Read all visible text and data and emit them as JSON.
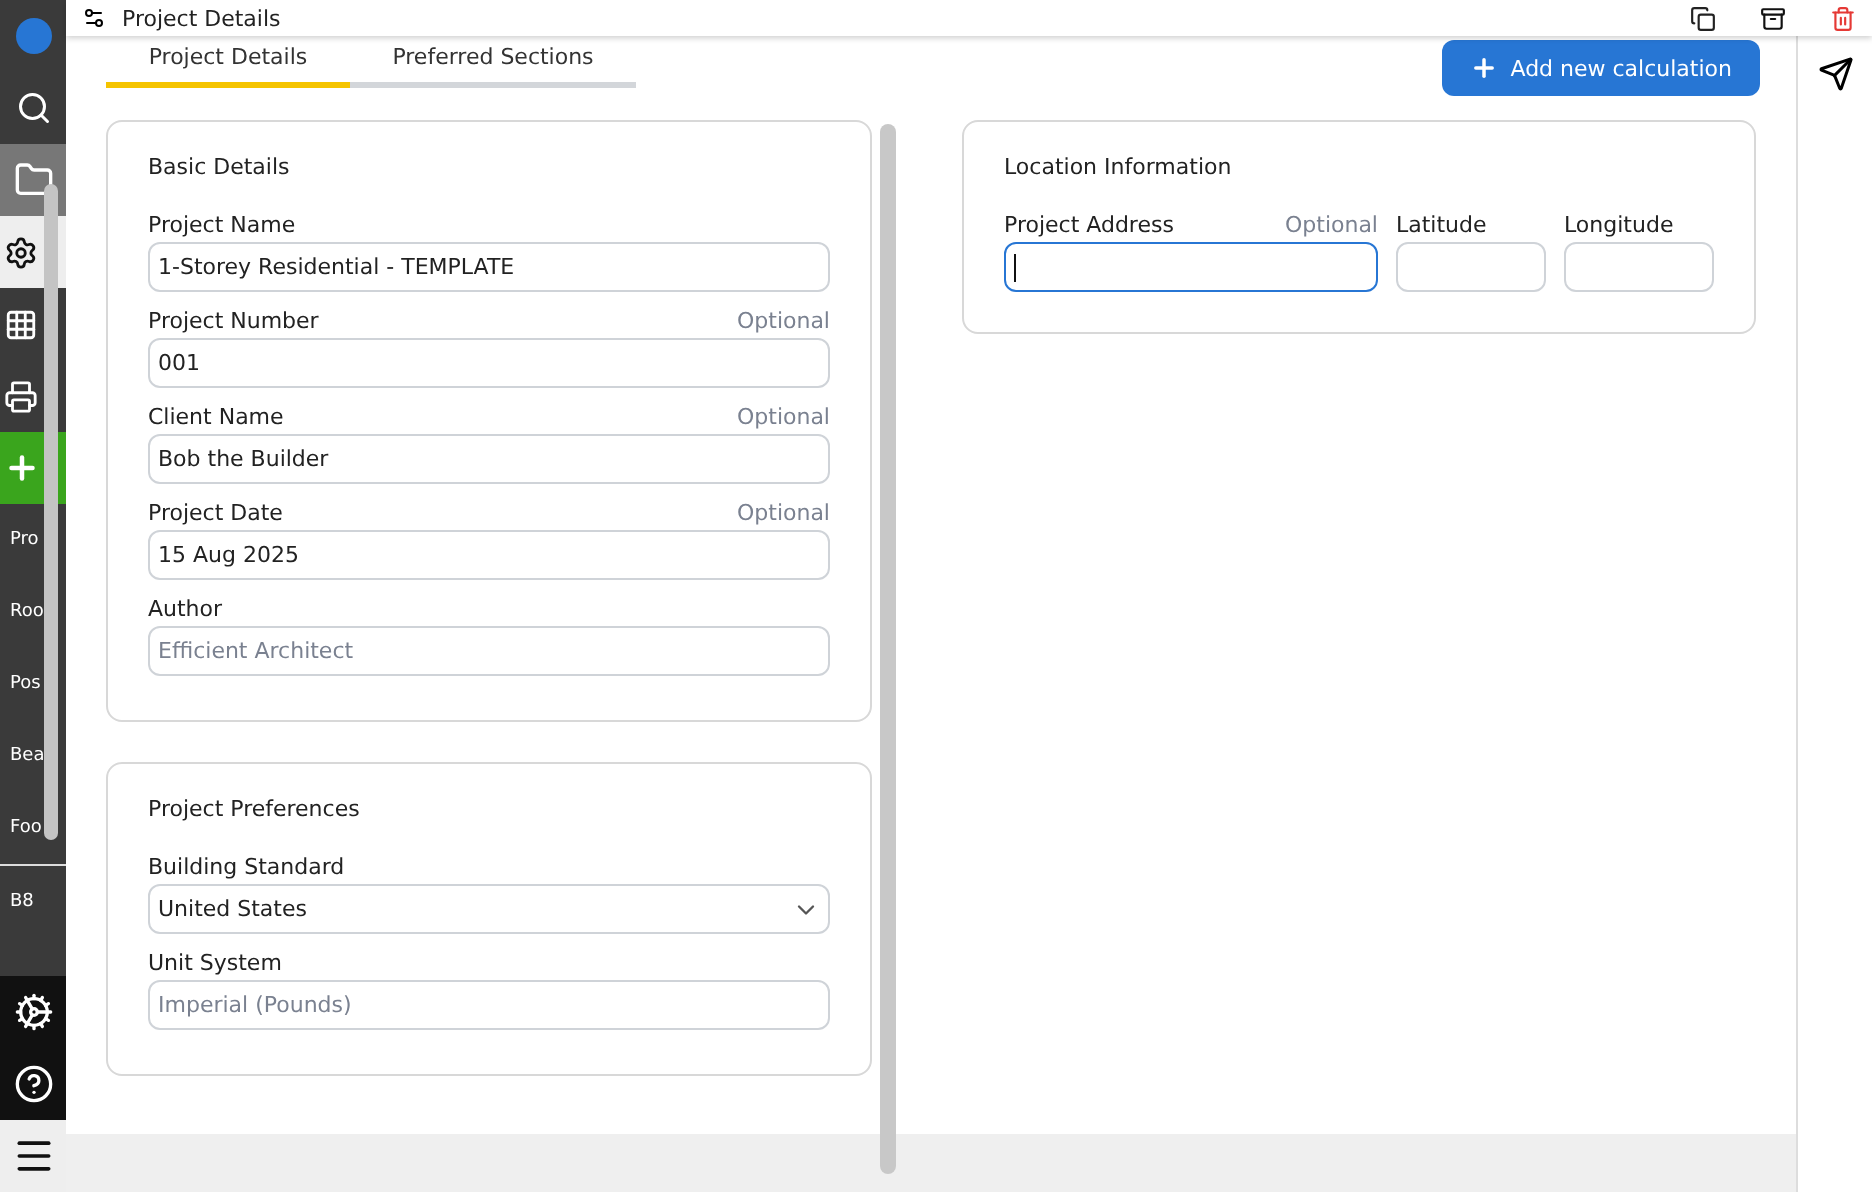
{
  "header": {
    "title": "Project Details"
  },
  "sidebar": {
    "items": [
      {
        "kind": "icon",
        "selected": false
      },
      {
        "kind": "icon",
        "selected": false
      },
      {
        "kind": "icon",
        "selected": false
      },
      {
        "kind": "icon",
        "selected": true
      },
      {
        "kind": "icon",
        "selected": false
      },
      {
        "kind": "icon",
        "selected": false
      },
      {
        "kind": "icon",
        "selected": false
      },
      {
        "kind": "text",
        "label": "Pro"
      },
      {
        "kind": "text",
        "label": "Roo"
      },
      {
        "kind": "text",
        "label": "Pos"
      },
      {
        "kind": "text",
        "label": "Bea"
      },
      {
        "kind": "text",
        "label": "Foo"
      },
      {
        "kind": "text",
        "label": "B8"
      }
    ]
  },
  "tabs": [
    {
      "label": "Project Details",
      "selected": true
    },
    {
      "label": "Preferred Sections",
      "selected": false
    }
  ],
  "add_button": {
    "label": "Add new calculation"
  },
  "cards": [
    {
      "title": "Basic Details",
      "fields": [
        {
          "kind": "text",
          "label": "Project Name",
          "value": "1-Storey Residential - TEMPLATE"
        },
        {
          "kind": "text",
          "label": "Project Number",
          "optional_label": "Optional",
          "value": "001"
        },
        {
          "kind": "text",
          "label": "Client Name",
          "optional_label": "Optional",
          "value": "Bob the Builder"
        },
        {
          "kind": "text",
          "label": "Project Date",
          "optional_label": "Optional",
          "value": "15 Aug 2025"
        },
        {
          "kind": "text",
          "label": "Author",
          "placeholder": "Efficient Architect"
        }
      ]
    },
    {
      "title": "Project Preferences",
      "fields": [
        {
          "kind": "select",
          "label": "Building Standard",
          "value": "United States"
        },
        {
          "kind": "text",
          "label": "Unit System",
          "placeholder": "Imperial (Pounds)"
        }
      ]
    }
  ],
  "location": {
    "title": "Location Information",
    "fields": [
      {
        "label": "Project Address",
        "optional_label": "Optional",
        "focused": true
      },
      {
        "label": "Latitude",
        "focused": false
      },
      {
        "label": "Longitude",
        "focused": false
      }
    ]
  }
}
